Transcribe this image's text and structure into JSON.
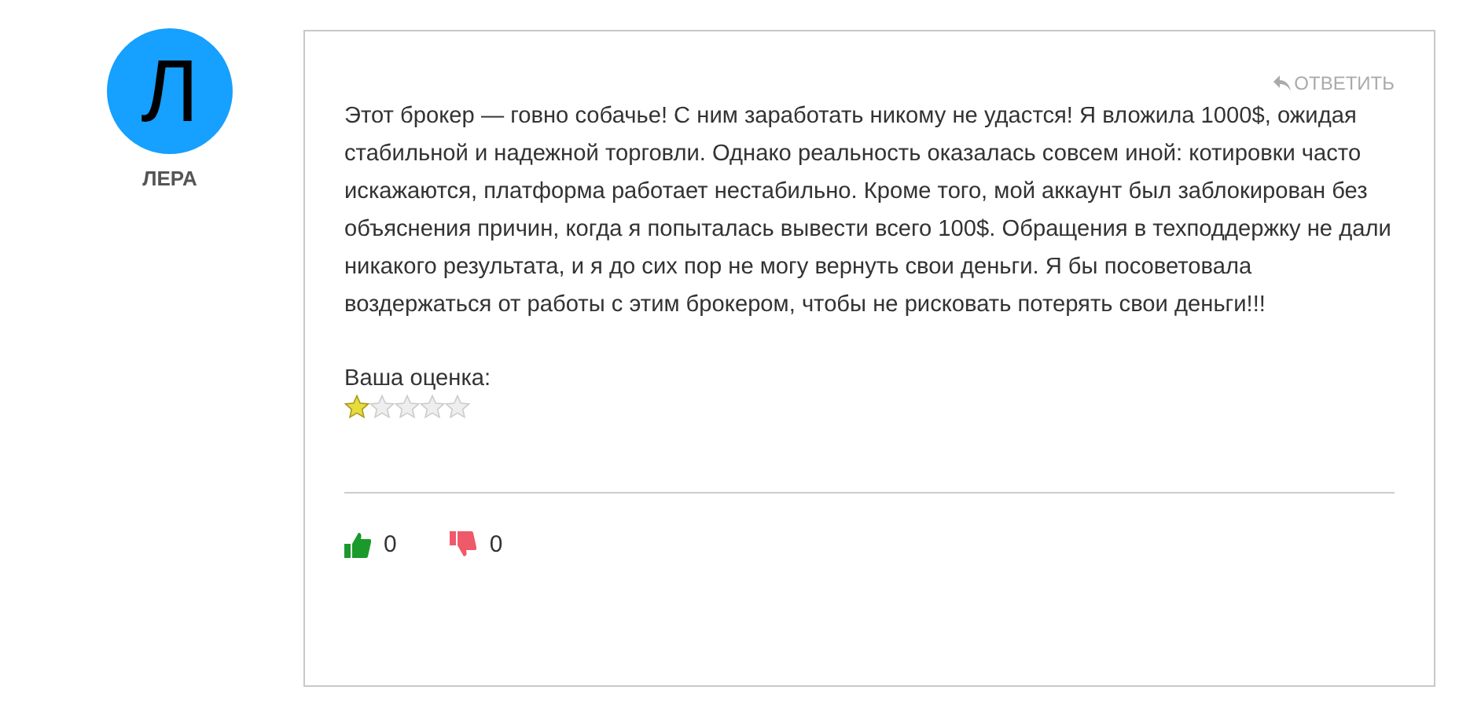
{
  "author": {
    "initial": "Л",
    "name": "ЛЕРА"
  },
  "review": {
    "reply": "ОТВЕТИТЬ",
    "text": "Этот брокер — говно собачье! С ним заработать никому не удастся! Я вложила 1000$, ожидая стабильной и надежной торговли. Однако реальность оказалась совсем иной: котировки часто искажаются, платформа работает нестабильно. Кроме того, мой аккаунт был заблокирован без объяснения причин, когда я попыталась вывести всего 100$. Обращения в техподдержку не дали никакого результата, и я до сих пор не могу вернуть свои деньги. Я бы посоветовала воздержаться от работы с этим брокером, чтобы не рисковать потерять свои деньги!!!",
    "rating_label": "Ваша оценка:",
    "stars": 1,
    "likes": "0",
    "dislikes": "0"
  }
}
